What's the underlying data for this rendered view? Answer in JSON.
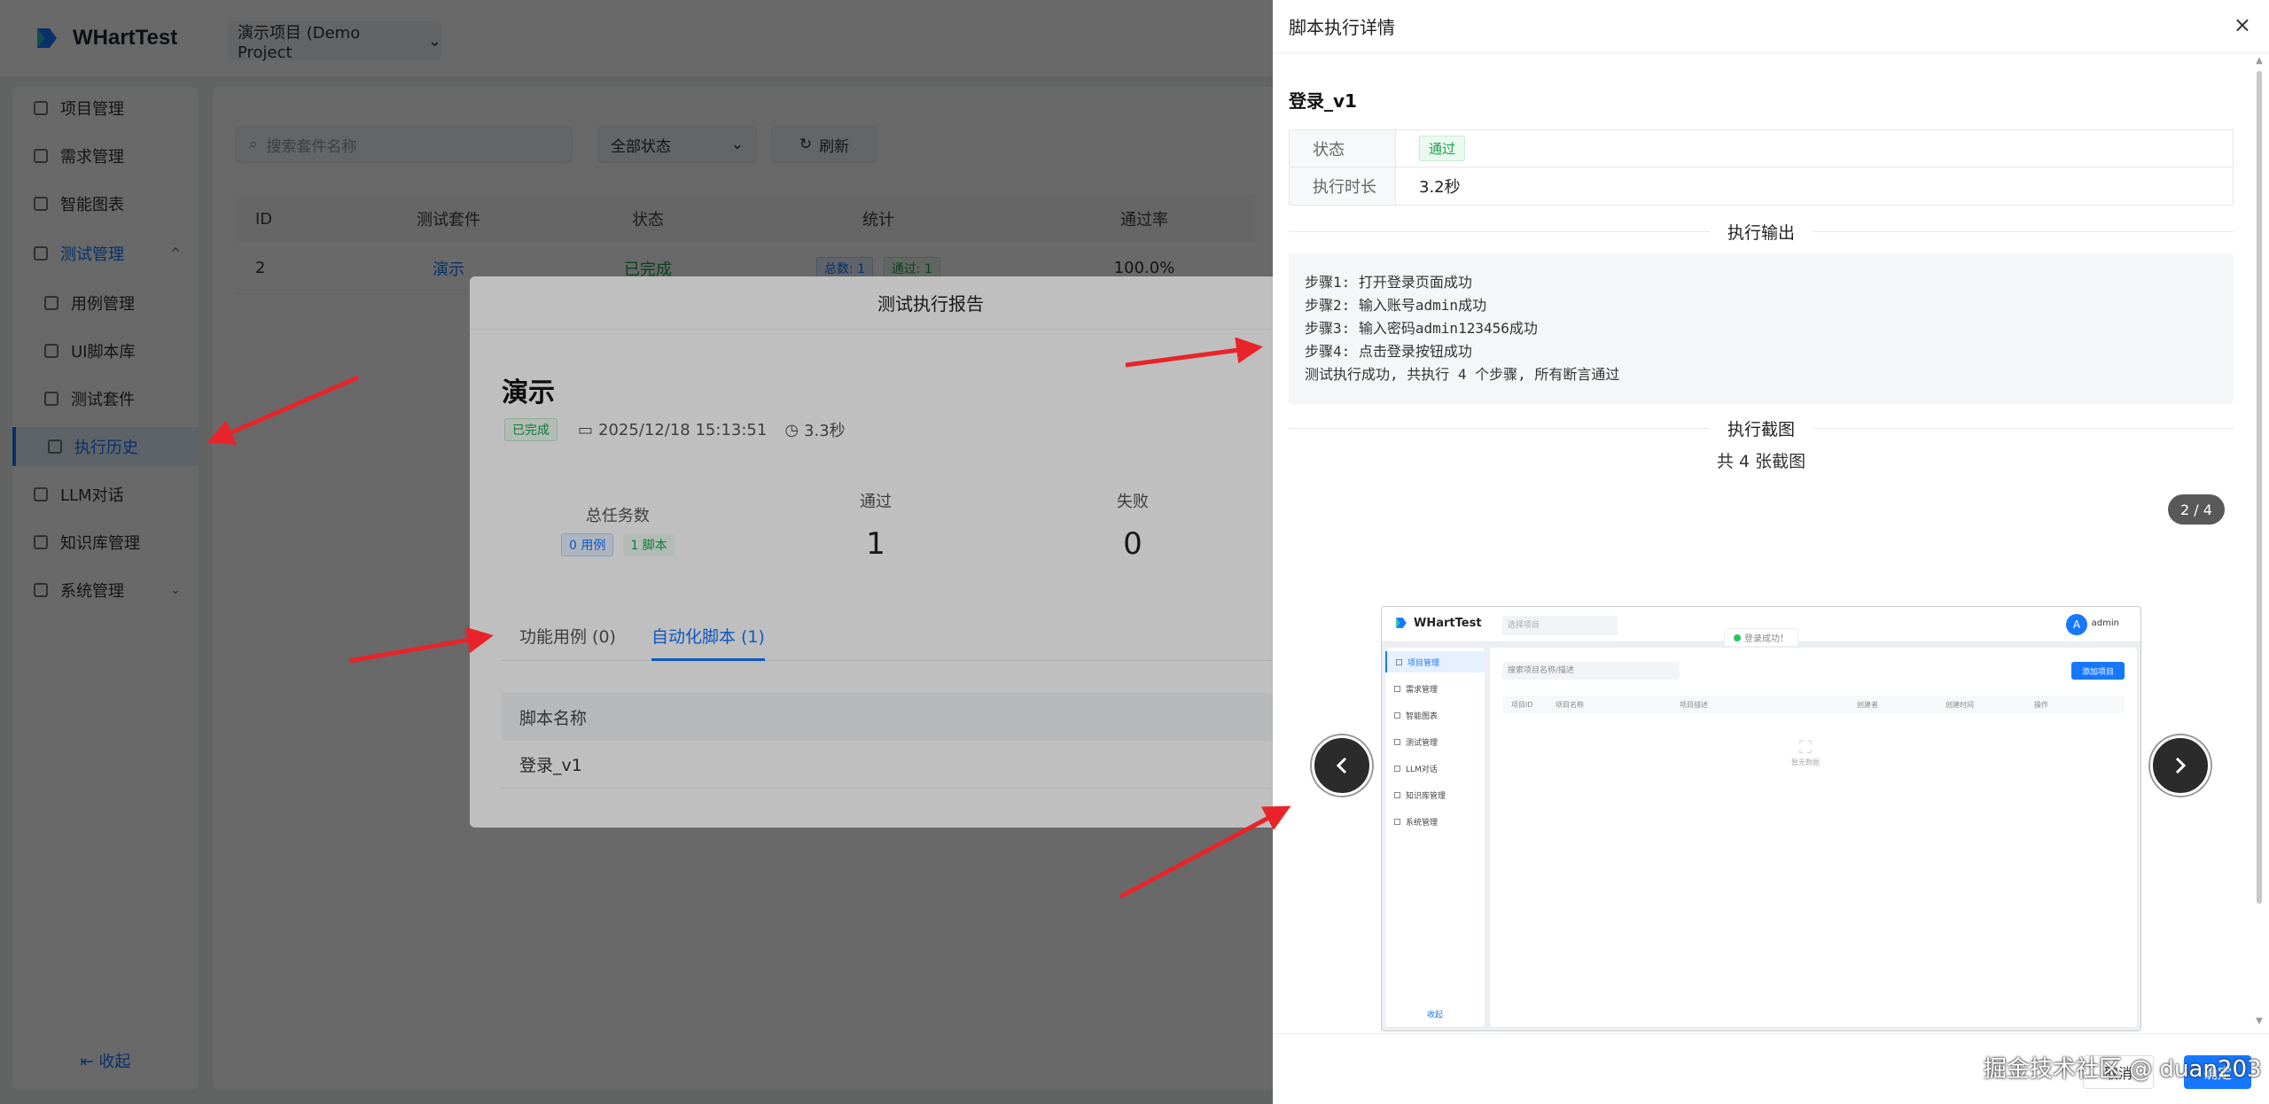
{
  "app": {
    "logo_text": "WHartTest",
    "project": "演示项目 (Demo Project"
  },
  "sidebar": {
    "items": [
      {
        "label": "项目管理"
      },
      {
        "label": "需求管理"
      },
      {
        "label": "智能图表"
      },
      {
        "label": "测试管理"
      },
      {
        "label": "用例管理"
      },
      {
        "label": "UI脚本库"
      },
      {
        "label": "测试套件"
      },
      {
        "label": "执行历史"
      },
      {
        "label": "LLM对话"
      },
      {
        "label": "知识库管理"
      },
      {
        "label": "系统管理"
      }
    ],
    "collapse": "收起"
  },
  "content": {
    "search_placeholder": "搜索套件名称",
    "status_filter": "全部状态",
    "refresh": "刷新",
    "columns": [
      "ID",
      "测试套件",
      "状态",
      "统计",
      "通过率"
    ],
    "row": {
      "id": "2",
      "suite": "演示",
      "status": "已完成",
      "total": "总数: 1",
      "passed": "通过: 1",
      "rate": "100.0%"
    }
  },
  "report": {
    "title": "测试执行报告",
    "name": "演示",
    "status": "已完成",
    "datetime": "2025/12/18 15:13:51",
    "duration": "3.3秒",
    "total_label": "总任务数",
    "case_badge": "0 用例",
    "script_badge": "1 脚本",
    "passed_label": "通过",
    "passed_value": "1",
    "failed_label": "失败",
    "failed_value": "0",
    "tabs": [
      "功能用例 (0)",
      "自动化脚本 (1)"
    ],
    "script_col": "脚本名称",
    "script_row": "登录_v1"
  },
  "drawer": {
    "title": "脚本执行详情",
    "close": "×",
    "script_name": "登录_v1",
    "status_label": "状态",
    "status_value": "通过",
    "duration_label": "执行时长",
    "duration_value": "3.2秒",
    "output_title": "执行输出",
    "output_lines": [
      "步骤1: 打开登录页面成功",
      "步骤2: 输入账号admin成功",
      "步骤3: 输入密码admin123456成功",
      "步骤4: 点击登录按钮成功",
      "测试执行成功, 共执行 4 个步骤, 所有断言通过"
    ],
    "screenshot_title": "执行截图",
    "screenshot_count": "共 4 张截图",
    "page_indicator": "2 / 4",
    "footer_cancel": "取消",
    "footer_confirm": "确定"
  },
  "screenshot": {
    "logo_text": "WHartTest",
    "project_placeholder": "选择项目",
    "toast": "登录成功！",
    "avatar": "A",
    "user": "admin",
    "side_items": [
      "项目管理",
      "需求管理",
      "智能图表",
      "测试管理",
      "LLM对话",
      "知识库管理",
      "系统管理"
    ],
    "collapse": "收起",
    "search_placeholder": "搜索项目名称/描述",
    "add_button": "添加项目",
    "columns": [
      "项目ID",
      "项目名称",
      "项目描述",
      "创建者",
      "创建时间",
      "操作"
    ],
    "empty": "暂无数据"
  },
  "watermark": "掘金技术社区 @ duan203",
  "colors": {
    "primary": "#1677ff",
    "success": "#16a34a",
    "annotation": "#e8242a"
  }
}
